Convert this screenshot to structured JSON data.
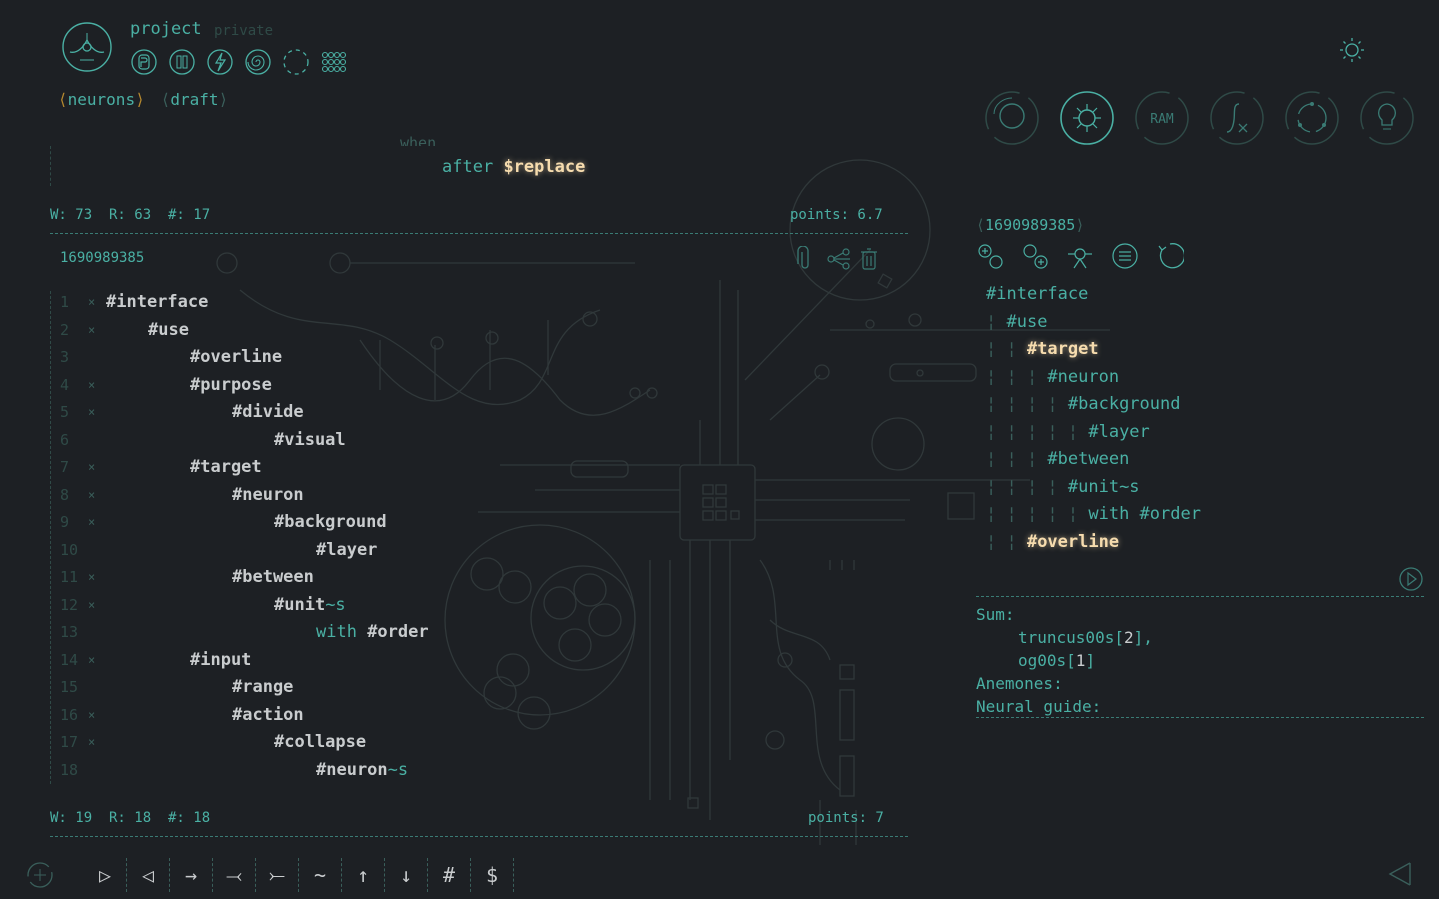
{
  "header": {
    "title": "project",
    "visibility": "private",
    "mode_icons": [
      "r-circle-icon",
      "pause-circle-icon",
      "bolt-circle-icon",
      "spiral-icon",
      "dashed-circle-icon",
      "grid-dots-icon"
    ],
    "breadcrumbs": [
      "neurons",
      "draft"
    ],
    "theme_icon": "sun-icon"
  },
  "right_nav": {
    "icons": [
      "search-icon",
      "neuron-icon",
      "ram-icon",
      "function-icon",
      "cycle-icon",
      "bulb-icon"
    ]
  },
  "top_editor": {
    "snippet_when": "when",
    "snippet_after_kw": "after",
    "snippet_after_var": "$replace",
    "stats": "W: 73  R: 63  #: 17",
    "points": "points: 6.7"
  },
  "editor": {
    "id": "1690989385",
    "tool_icons": [
      "paperclip-icon",
      "share-icon",
      "trash-icon"
    ],
    "lines": [
      {
        "n": "1",
        "x": "×",
        "text": "#interface"
      },
      {
        "n": "2",
        "x": "×",
        "text": "#use"
      },
      {
        "n": "3",
        "x": "",
        "text": "#overline"
      },
      {
        "n": "4",
        "x": "×",
        "text": "#purpose"
      },
      {
        "n": "5",
        "x": "×",
        "text": "#divide"
      },
      {
        "n": "6",
        "x": "",
        "text": "#visual"
      },
      {
        "n": "7",
        "x": "×",
        "text": "#target"
      },
      {
        "n": "8",
        "x": "×",
        "text": "#neuron"
      },
      {
        "n": "9",
        "x": "×",
        "text": "#background"
      },
      {
        "n": "10",
        "x": "",
        "text": "#layer"
      },
      {
        "n": "11",
        "x": "×",
        "text": "#between"
      },
      {
        "n": "12",
        "x": "×",
        "text": "#unit",
        "suffix": "~s"
      },
      {
        "n": "13",
        "x": "",
        "prefix": "with ",
        "text": "#order"
      },
      {
        "n": "14",
        "x": "×",
        "text": "#input"
      },
      {
        "n": "15",
        "x": "",
        "text": "#range"
      },
      {
        "n": "16",
        "x": "×",
        "text": "#action"
      },
      {
        "n": "17",
        "x": "×",
        "text": "#collapse"
      },
      {
        "n": "18",
        "x": "",
        "text": "#neuron",
        "suffix": "~s"
      }
    ],
    "stats": "W: 19  R: 18  #: 18",
    "points": "points: 7"
  },
  "toolbar": {
    "buttons": [
      "▷",
      "◁",
      "→",
      "⤙",
      "⤚",
      "~",
      "↑",
      "↓",
      "#",
      "$"
    ],
    "add_icon": "add-circle-icon",
    "back_icon": "back-triangle-icon"
  },
  "right_panel": {
    "id": "1690989385",
    "tool_icons": [
      "add-node-icon",
      "add-child-icon",
      "branch-icon",
      "list-icon",
      "refresh-icon"
    ],
    "tree": [
      {
        "text": "#interface"
      },
      {
        "text": "#use"
      },
      {
        "text": "#target"
      },
      {
        "text": "#neuron"
      },
      {
        "text": "#background"
      },
      {
        "text": "#layer"
      },
      {
        "text": "#between"
      },
      {
        "text": "#unit~s"
      },
      {
        "text": "with #order"
      },
      {
        "text": "#overline"
      }
    ],
    "play_icon": "play-circle-icon",
    "sum_label": "Sum:",
    "sum_item1_name": "truncus00s[",
    "sum_item1_num": "2",
    "sum_item1_end": "],",
    "sum_item2_name": "og00s[",
    "sum_item2_num": "1",
    "sum_item2_end": "]",
    "anemones_label": "Anemones:",
    "guide_label": "Neural guide:"
  },
  "colors": {
    "background": "#1d2024",
    "accent": "#4ab0a4",
    "highlight": "#f6dcae",
    "tag": "#c9ccce",
    "muted": "#3a5f5b"
  }
}
